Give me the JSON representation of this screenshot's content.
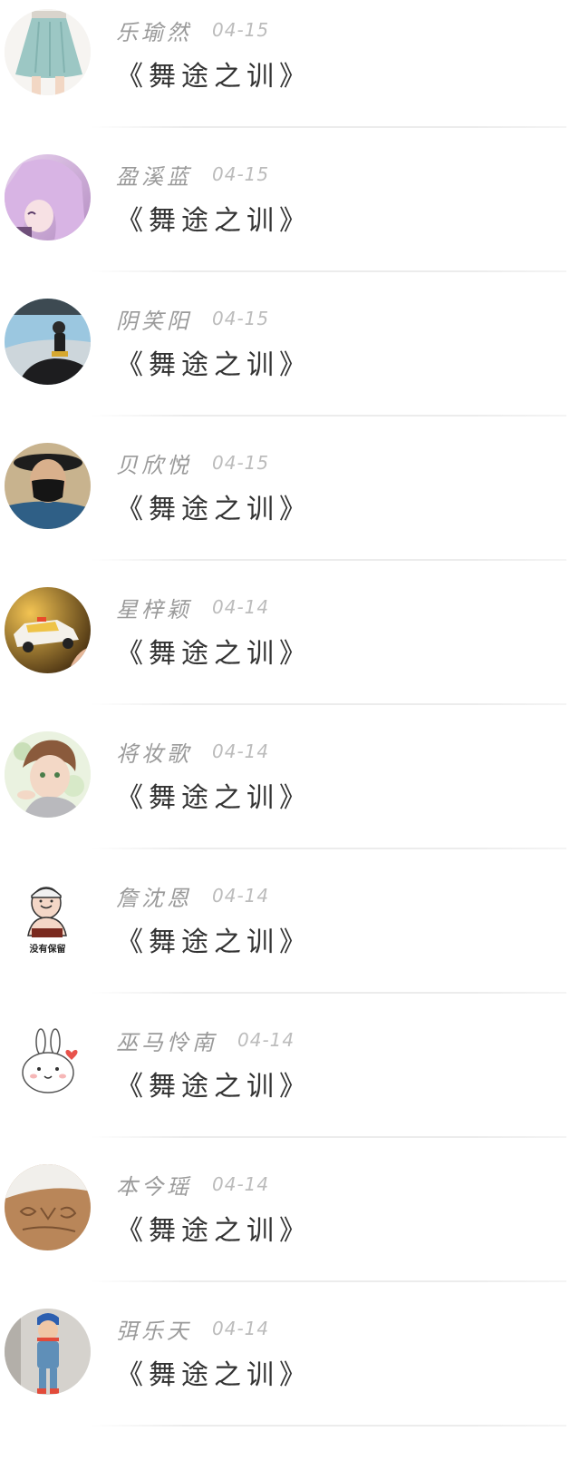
{
  "posts": [
    {
      "user": "乐瑜然",
      "date": "04-15",
      "title": "《舞途之训》",
      "avatar": "skirt-photo-avatar"
    },
    {
      "user": "盈溪蓝",
      "date": "04-15",
      "title": "《舞途之训》",
      "avatar": "anime-girl-avatar"
    },
    {
      "user": "阴笑阳",
      "date": "04-15",
      "title": "《舞途之训》",
      "avatar": "beach-sitting-avatar"
    },
    {
      "user": "贝欣悦",
      "date": "04-15",
      "title": "《舞途之训》",
      "avatar": "masked-boy-avatar"
    },
    {
      "user": "星梓颖",
      "date": "04-14",
      "title": "《舞途之训》",
      "avatar": "toy-taxi-avatar"
    },
    {
      "user": "将妆歌",
      "date": "04-14",
      "title": "《舞途之训》",
      "avatar": "anime-boy-avatar"
    },
    {
      "user": "詹沈恩",
      "date": "04-14",
      "title": "《舞途之训》",
      "avatar": "meme-face-avatar",
      "avatar_text": "没有保留"
    },
    {
      "user": "巫马怜南",
      "date": "04-14",
      "title": "《舞途之训》",
      "avatar": "cartoon-rabbit-avatar"
    },
    {
      "user": "本今瑶",
      "date": "04-14",
      "title": "《舞途之训》",
      "avatar": "sand-drawing-avatar"
    },
    {
      "user": "弭乐天",
      "date": "04-14",
      "title": "《舞途之训》",
      "avatar": "toddler-photo-avatar"
    }
  ]
}
